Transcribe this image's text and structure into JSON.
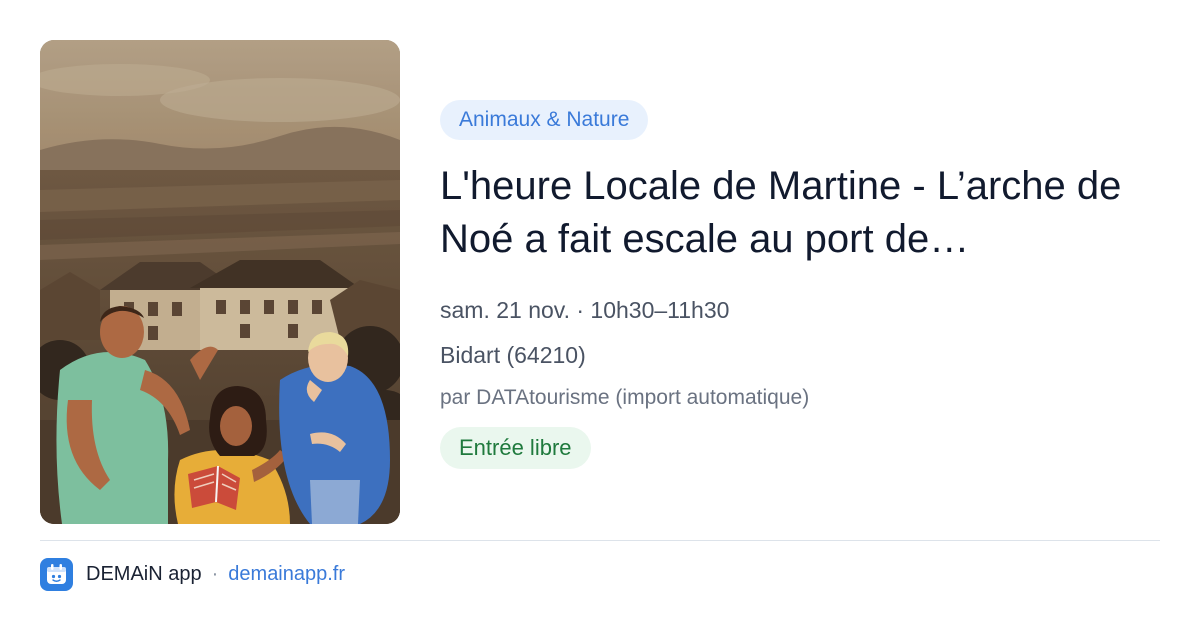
{
  "event": {
    "category": "Animaux & Nature",
    "title": "L'heure Locale de Martine - L’arche de Noé a fait escale au port de…",
    "datetime": "sam. 21 nov. · 10h30–11h30",
    "location": "Bidart (64210)",
    "organizer": "par DATAtourisme (import automatique)",
    "price": "Entrée libre"
  },
  "footer": {
    "app_name": "DEMAiN app",
    "separator": "·",
    "domain": "demainapp.fr"
  },
  "colors": {
    "category_chip_bg": "#e8f1fd",
    "category_chip_text": "#3a7ad9",
    "price_chip_bg": "#eaf7ee",
    "price_chip_text": "#1f7a3d",
    "link": "#3a7ad9",
    "logo_bg": "#2f7fe0"
  },
  "icons": {
    "app_logo": "demain-app-logo-icon"
  }
}
